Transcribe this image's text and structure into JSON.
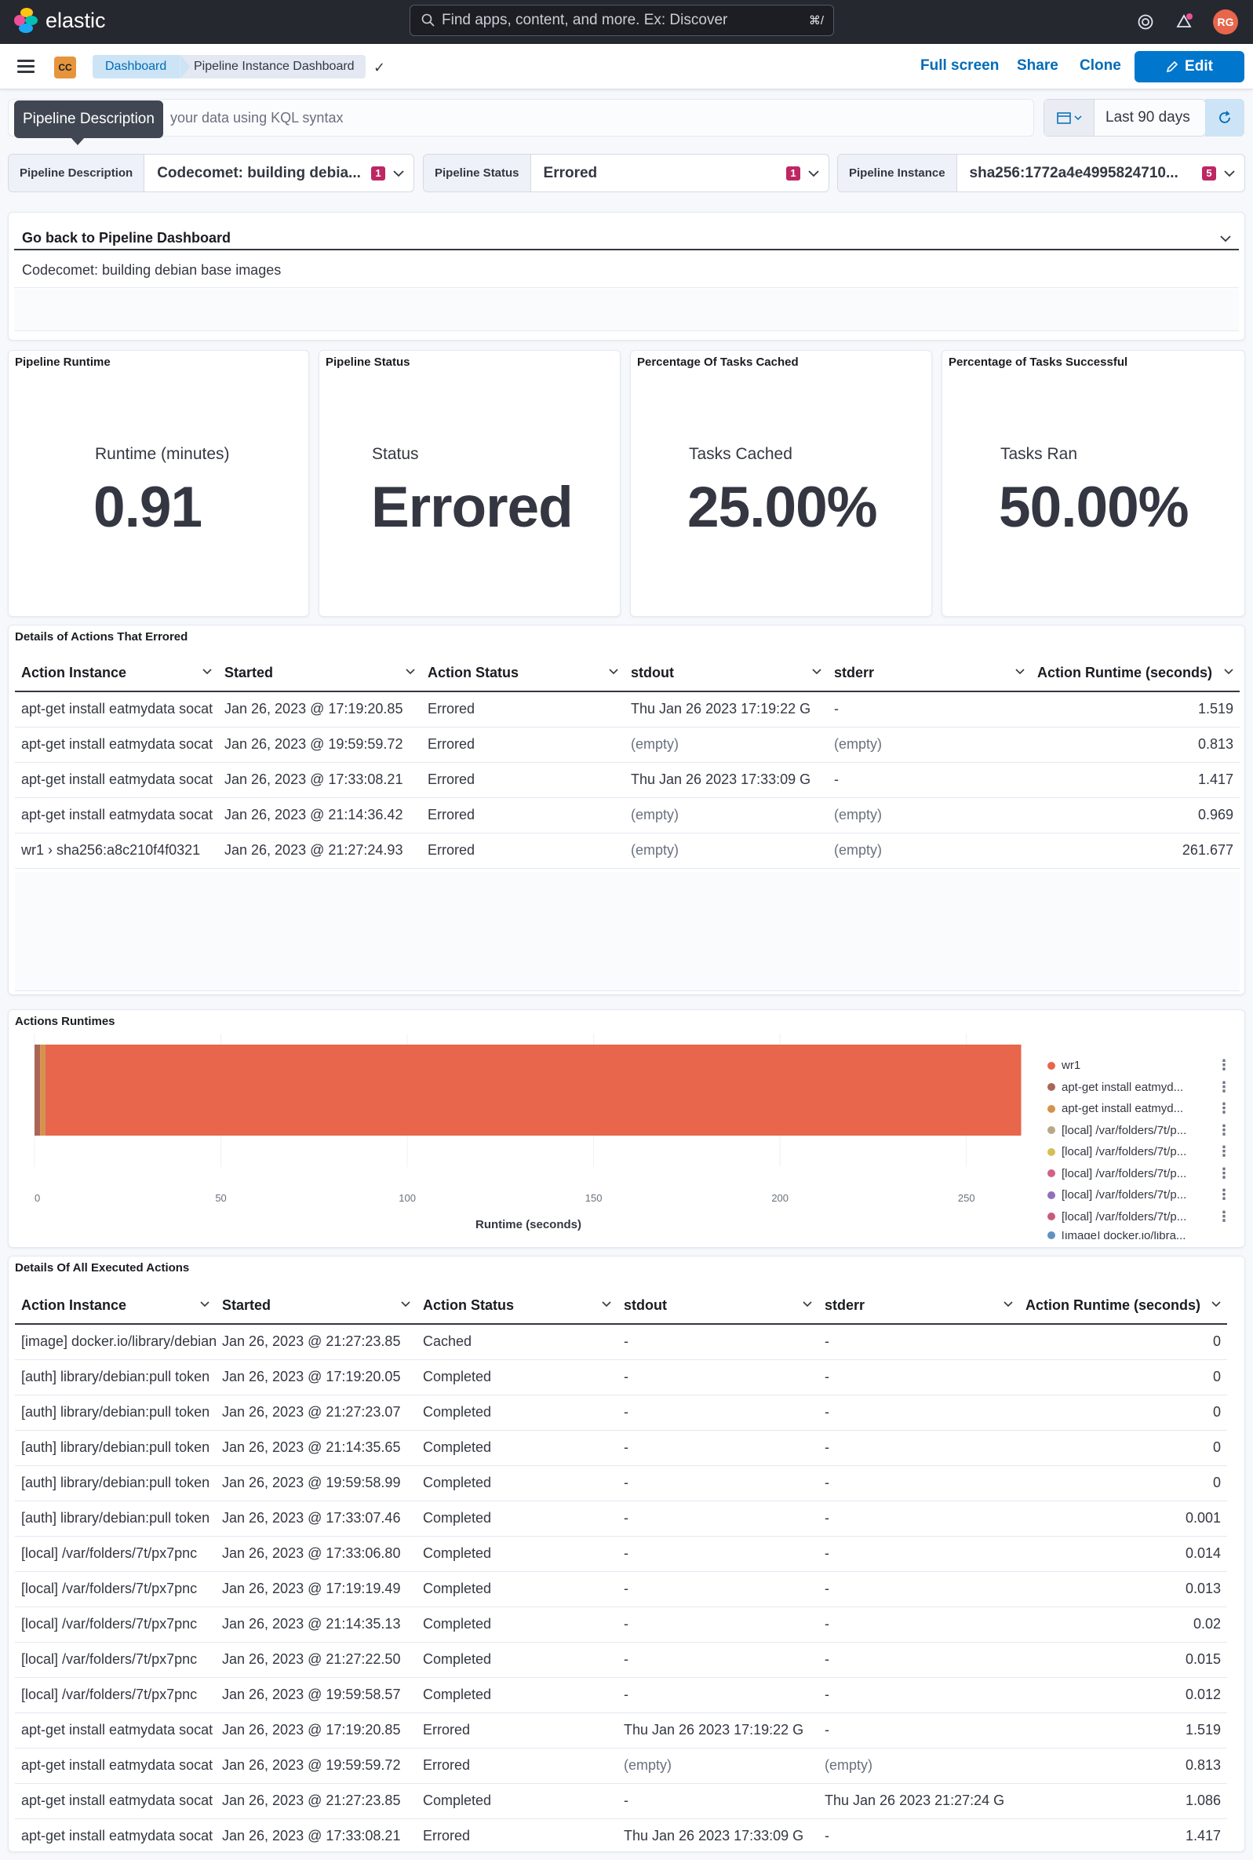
{
  "app": {
    "logo_text": "elastic",
    "search_placeholder": "Find apps, content, and more. Ex: Discover",
    "search_shortcut": "⌘/",
    "avatar_initials": "RG"
  },
  "header": {
    "space_badge": "CC",
    "breadcrumb_1": "Dashboard",
    "breadcrumb_2": "Pipeline Instance Dashboard",
    "full_screen": "Full screen",
    "share": "Share",
    "clone": "Clone",
    "edit": "Edit"
  },
  "query": {
    "tooltip": "Pipeline Description",
    "placeholder": "your data using KQL syntax",
    "date_range": "Last 90 days"
  },
  "controls": [
    {
      "label": "Pipeline Description",
      "value": "Codecomet: building debia...",
      "count": "1"
    },
    {
      "label": "Pipeline Status",
      "value": "Errored",
      "count": "1"
    },
    {
      "label": "Pipeline Instance",
      "value": "sha256:1772a4e4995824710...",
      "count": "5"
    }
  ],
  "back_panel": {
    "title": "Go back to Pipeline Dashboard",
    "row": "Codecomet: building debian base images"
  },
  "metrics": [
    {
      "panel_title": "Pipeline Runtime",
      "label": "Runtime (minutes)",
      "value": "0.91"
    },
    {
      "panel_title": "Pipeline Status",
      "label": "Status",
      "value": "Errored"
    },
    {
      "panel_title": "Percentage Of Tasks Cached",
      "label": "Tasks Cached",
      "value": "25.00%"
    },
    {
      "panel_title": "Percentage of Tasks Successful",
      "label": "Tasks Ran",
      "value": "50.00%"
    }
  ],
  "errored_table": {
    "title": "Details of Actions That Errored",
    "columns": [
      "Action Instance",
      "Started",
      "Action Status",
      "stdout",
      "stderr",
      "Action Runtime (seconds)"
    ],
    "rows": [
      [
        "apt-get install eatmydata socat",
        "Jan 26, 2023 @ 17:19:20.85",
        "Errored",
        "Thu Jan 26 2023 17:19:22 G",
        "-",
        "1.519"
      ],
      [
        "apt-get install eatmydata socat",
        "Jan 26, 2023 @ 19:59:59.72",
        "Errored",
        "(empty)",
        "(empty)",
        "0.813"
      ],
      [
        "apt-get install eatmydata socat",
        "Jan 26, 2023 @ 17:33:08.21",
        "Errored",
        "Thu Jan 26 2023 17:33:09 G",
        "-",
        "1.417"
      ],
      [
        "apt-get install eatmydata socat",
        "Jan 26, 2023 @ 21:14:36.42",
        "Errored",
        "(empty)",
        "(empty)",
        "0.969"
      ],
      [
        "wr1 › sha256:a8c210f4f0321",
        "Jan 26, 2023 @ 21:27:24.93",
        "Errored",
        "(empty)",
        "(empty)",
        "261.677"
      ]
    ]
  },
  "chart_panel": {
    "title": "Actions Runtimes"
  },
  "chart_data": {
    "type": "bar",
    "orientation": "horizontal",
    "stacked": true,
    "xlabel": "Runtime (seconds)",
    "xlim": [
      0,
      265
    ],
    "xticks": [
      "0",
      "50",
      "100",
      "150",
      "200",
      "250"
    ],
    "series": [
      {
        "name": "wr1",
        "values": [
          261.677
        ],
        "color": "#e7664c"
      },
      {
        "name": "apt-get install eatmyd...",
        "values": [
          1.519
        ],
        "color": "#aa6556"
      },
      {
        "name": "apt-get install eatmyd...",
        "values": [
          1.417
        ],
        "color": "#d6924a"
      },
      {
        "name": "[local] /var/folders/7t/p...",
        "values": [
          0.014
        ],
        "color": "#b9a888"
      },
      {
        "name": "[local] /var/folders/7t/p...",
        "values": [
          0.013
        ],
        "color": "#d6bf57"
      },
      {
        "name": "[local] /var/folders/7t/p...",
        "values": [
          0.02
        ],
        "color": "#d36086"
      },
      {
        "name": "[local] /var/folders/7t/p...",
        "values": [
          0.015
        ],
        "color": "#9170b8"
      },
      {
        "name": "[local] /var/folders/7t/p...",
        "values": [
          0.012
        ],
        "color": "#ca5a7a"
      },
      {
        "name": "[image] docker.io/libra...",
        "values": [
          0
        ],
        "color": "#6092c0"
      }
    ]
  },
  "all_table": {
    "title": "Details Of All Executed Actions",
    "columns": [
      "Action Instance",
      "Started",
      "Action Status",
      "stdout",
      "stderr",
      "Action Runtime (seconds)"
    ],
    "rows": [
      [
        "[image] docker.io/library/debian",
        "Jan 26, 2023 @ 21:27:23.85",
        "Cached",
        "-",
        "-",
        "0"
      ],
      [
        "[auth] library/debian:pull token",
        "Jan 26, 2023 @ 17:19:20.05",
        "Completed",
        "-",
        "-",
        "0"
      ],
      [
        "[auth] library/debian:pull token",
        "Jan 26, 2023 @ 21:27:23.07",
        "Completed",
        "-",
        "-",
        "0"
      ],
      [
        "[auth] library/debian:pull token",
        "Jan 26, 2023 @ 21:14:35.65",
        "Completed",
        "-",
        "-",
        "0"
      ],
      [
        "[auth] library/debian:pull token",
        "Jan 26, 2023 @ 19:59:58.99",
        "Completed",
        "-",
        "-",
        "0"
      ],
      [
        "[auth] library/debian:pull token",
        "Jan 26, 2023 @ 17:33:07.46",
        "Completed",
        "-",
        "-",
        "0.001"
      ],
      [
        "[local] /var/folders/7t/px7pnc",
        "Jan 26, 2023 @ 17:33:06.80",
        "Completed",
        "-",
        "-",
        "0.014"
      ],
      [
        "[local] /var/folders/7t/px7pnc",
        "Jan 26, 2023 @ 17:19:19.49",
        "Completed",
        "-",
        "-",
        "0.013"
      ],
      [
        "[local] /var/folders/7t/px7pnc",
        "Jan 26, 2023 @ 21:14:35.13",
        "Completed",
        "-",
        "-",
        "0.02"
      ],
      [
        "[local] /var/folders/7t/px7pnc",
        "Jan 26, 2023 @ 21:27:22.50",
        "Completed",
        "-",
        "-",
        "0.015"
      ],
      [
        "[local] /var/folders/7t/px7pnc",
        "Jan 26, 2023 @ 19:59:58.57",
        "Completed",
        "-",
        "-",
        "0.012"
      ],
      [
        "apt-get install eatmydata socat",
        "Jan 26, 2023 @ 17:19:20.85",
        "Errored",
        "Thu Jan 26 2023 17:19:22 G",
        "-",
        "1.519"
      ],
      [
        "apt-get install eatmydata socat",
        "Jan 26, 2023 @ 19:59:59.72",
        "Errored",
        "(empty)",
        "(empty)",
        "0.813"
      ],
      [
        "apt-get install eatmydata socat",
        "Jan 26, 2023 @ 21:27:23.85",
        "Completed",
        "-",
        "Thu Jan 26 2023 21:27:24 G",
        "1.086"
      ],
      [
        "apt-get install eatmydata socat",
        "Jan 26, 2023 @ 17:33:08.21",
        "Errored",
        "Thu Jan 26 2023 17:33:09 G",
        "-",
        "1.417"
      ]
    ]
  }
}
